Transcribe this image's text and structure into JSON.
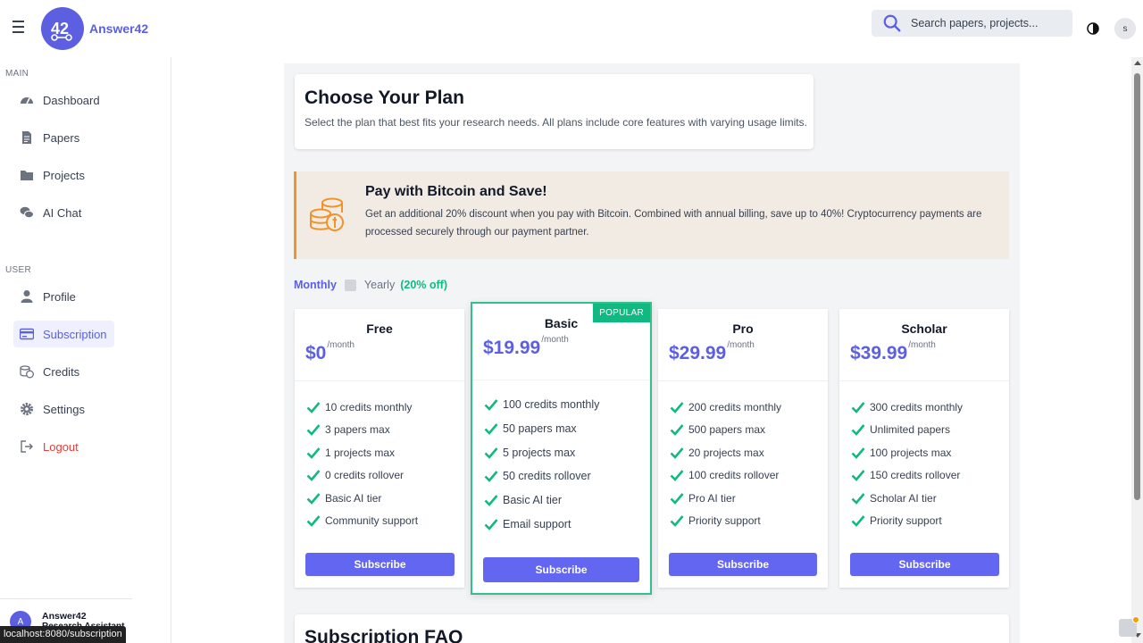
{
  "header": {
    "brand": "Answer42",
    "logo_text": "42",
    "search_placeholder": "Search papers, projects...",
    "user_initial": "s"
  },
  "sidebar": {
    "main_label": "MAIN",
    "main_items": [
      {
        "label": "Dashboard",
        "icon": "dashboard-icon"
      },
      {
        "label": "Papers",
        "icon": "document-icon"
      },
      {
        "label": "Projects",
        "icon": "folder-icon"
      },
      {
        "label": "AI Chat",
        "icon": "chat-icon"
      }
    ],
    "user_label": "USER",
    "user_items": [
      {
        "label": "Profile",
        "icon": "user-icon"
      },
      {
        "label": "Subscription",
        "icon": "credit-card-icon",
        "active": true
      },
      {
        "label": "Credits",
        "icon": "coins-icon"
      },
      {
        "label": "Settings",
        "icon": "gear-icon"
      },
      {
        "label": "Logout",
        "icon": "logout-icon"
      }
    ],
    "footer": {
      "initial": "A",
      "name": "Answer42",
      "role": "Research Assistant"
    }
  },
  "status_bar_url": "localhost:8080/subscription",
  "page": {
    "title": "Choose Your Plan",
    "subtitle": "Select the plan that best fits your research needs. All plans include core features with varying usage limits."
  },
  "bitcoin_banner": {
    "title": "Pay with Bitcoin and Save!",
    "text": "Get an additional 20% discount when you pay with Bitcoin. Combined with annual billing, save up to 40%! Cryptocurrency payments are processed securely through our payment partner.",
    "icon": "bitcoin-coins-icon"
  },
  "billing_toggle": {
    "monthly": "Monthly",
    "yearly": "Yearly",
    "discount": "(20% off)",
    "yearly_checked": false
  },
  "plans": [
    {
      "name": "Free",
      "price": "$0",
      "period": "/month",
      "popular": false,
      "features": [
        "10 credits monthly",
        "3 papers max",
        "1 projects max",
        "0 credits rollover",
        "Basic AI tier",
        "Community support"
      ],
      "button": "Subscribe"
    },
    {
      "name": "Basic",
      "price": "$19.99",
      "period": "/month",
      "popular": true,
      "badge": "POPULAR",
      "features": [
        "100 credits monthly",
        "50 papers max",
        "5 projects max",
        "50 credits rollover",
        "Basic AI tier",
        "Email support"
      ],
      "button": "Subscribe"
    },
    {
      "name": "Pro",
      "price": "$29.99",
      "period": "/month",
      "popular": false,
      "features": [
        "200 credits monthly",
        "500 papers max",
        "20 projects max",
        "100 credits rollover",
        "Pro AI tier",
        "Priority support"
      ],
      "button": "Subscribe"
    },
    {
      "name": "Scholar",
      "price": "$39.99",
      "period": "/month",
      "popular": false,
      "features": [
        "300 credits monthly",
        "Unlimited papers",
        "100 projects max",
        "150 credits rollover",
        "Scholar AI tier",
        "Priority support"
      ],
      "button": "Subscribe"
    }
  ],
  "faq": {
    "title": "Subscription FAQ"
  },
  "colors": {
    "accent": "#5b5fe0",
    "button": "#6366f1",
    "success": "#10b981",
    "warning_border": "#f0932b",
    "banner_bg": "#f2ebe3",
    "logout": "#e0403b"
  }
}
